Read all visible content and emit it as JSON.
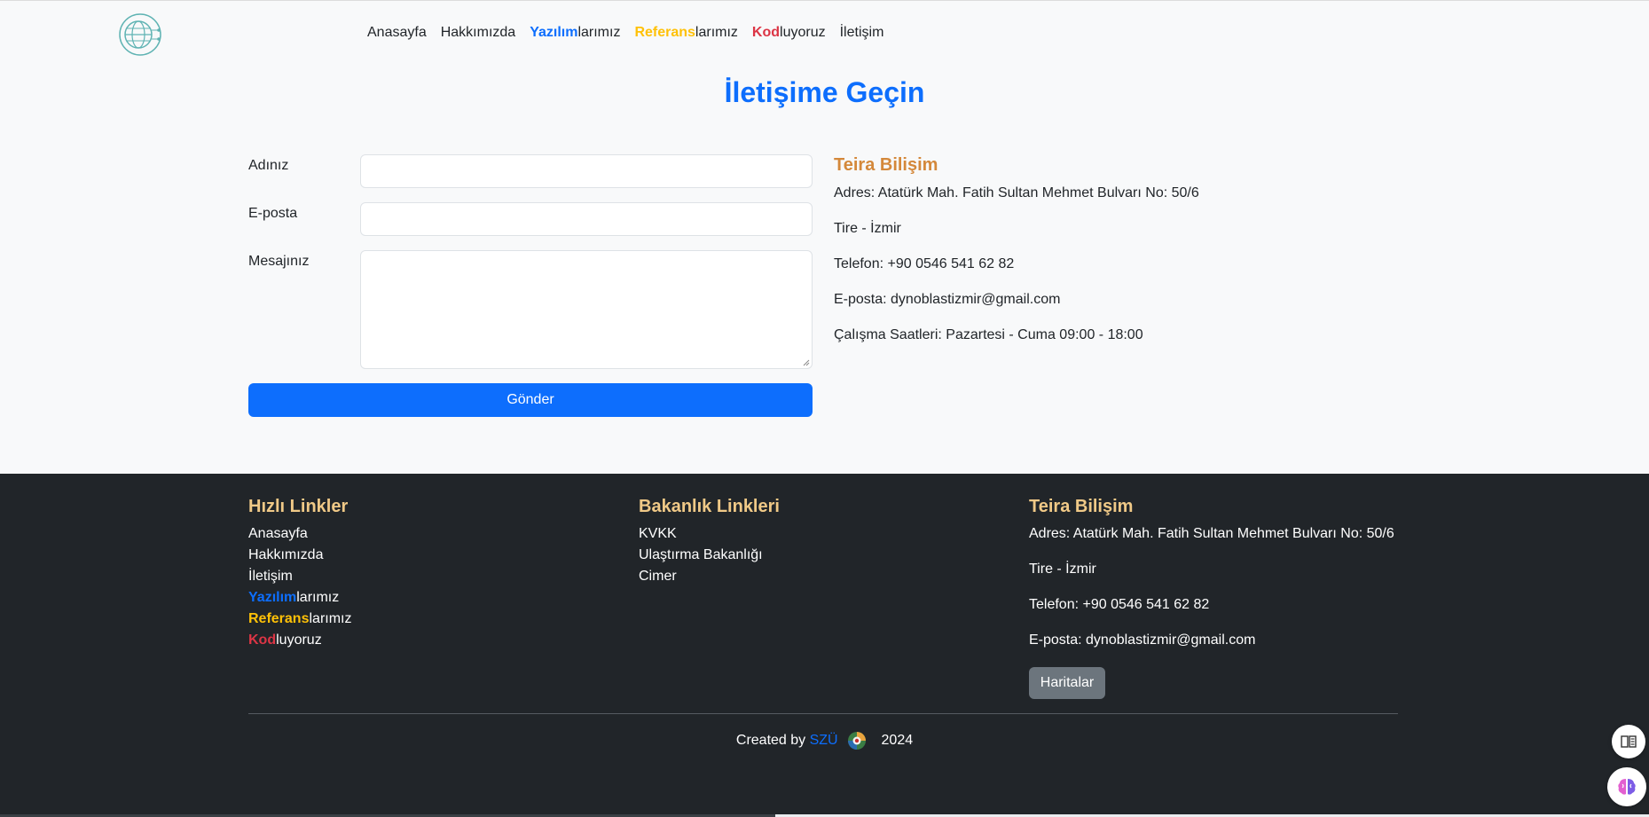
{
  "header": {
    "logo_icon": "globe-circuit-logo",
    "nav": [
      {
        "plain": "Anasayfa"
      },
      {
        "plain": "Hakkımızda"
      },
      {
        "accent": "Yazılım",
        "rest": "larımız",
        "color": "#0d6efd"
      },
      {
        "accent": "Referans",
        "rest": "larımız",
        "color": "#ffc107"
      },
      {
        "accent": "Kod",
        "rest": "luyoruz",
        "color": "#dc3545"
      },
      {
        "plain": "İletişim"
      }
    ]
  },
  "page": {
    "title": "İletişime Geçin"
  },
  "form": {
    "name_label": "Adınız",
    "name_value": "",
    "email_label": "E-posta",
    "email_value": "",
    "message_label": "Mesajınız",
    "message_value": "",
    "submit_label": "Gönder"
  },
  "contact": {
    "title": "Teira Bilişim",
    "address": "Adres: Atatürk Mah. Fatih Sultan Mehmet Bulvarı No: 50/6",
    "city": "Tire - İzmir",
    "phone": "Telefon: +90 0546 541 62 82",
    "email": "E-posta: dynoblastizmir@gmail.com",
    "hours": "Çalışma Saatleri: Pazartesi - Cuma 09:00 - 18:00"
  },
  "footer": {
    "quick_links_title": "Hızlı Linkler",
    "quick_links": {
      "home": "Anasayfa",
      "about": "Hakkımızda",
      "contact": "İletişim",
      "software_accent": "Yazılım",
      "software_rest": "larımız",
      "references_accent": "Referans",
      "references_rest": "larımız",
      "coding_accent": "Kod",
      "coding_rest": "luyoruz"
    },
    "ministry_title": "Bakanlık Linkleri",
    "ministry_links": {
      "kvkk": "KVKK",
      "transport": "Ulaştırma Bakanlığı",
      "cimer": "Cimer"
    },
    "company_title": "Teira Bilişim",
    "company": {
      "address": "Adres: Atatürk Mah. Fatih Sultan Mehmet Bulvarı No: 50/6",
      "city": "Tire - İzmir",
      "phone": "Telefon: +90 0546 541 62 82",
      "email": "E-posta: dynoblastizmir@gmail.com",
      "maps_button": "Haritalar"
    },
    "credit": {
      "prefix": "Created by",
      "author": "SZÜ",
      "year": "2024"
    }
  },
  "colors": {
    "primary": "#0d6efd",
    "warning": "#ffc107",
    "danger": "#dc3545",
    "heading_orange": "#d4883a",
    "footer_bg": "#212529",
    "footer_title": "#f0c987"
  },
  "floating": {
    "reader_icon": "book-reader-icon",
    "ai_icon": "brain-icon"
  }
}
